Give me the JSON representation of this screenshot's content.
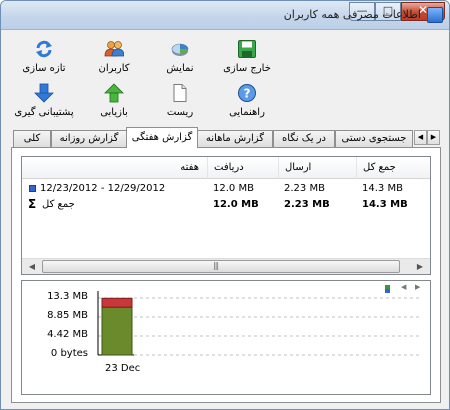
{
  "window": {
    "title": "اطلاعات مصرفی همه کاربران",
    "close_glyph": "✕",
    "maximize_glyph": "□",
    "minimize_glyph": "—"
  },
  "toolbar": {
    "refresh": "تازه سازی",
    "users": "کاربران",
    "view": "نمایش",
    "exit": "خارج سازی",
    "backup": "پشتیبانی گیری",
    "restore": "بازیابی",
    "reset": "ریست",
    "help": "راهنمایی"
  },
  "tabs": {
    "items": [
      "جستجوی دستی",
      "در یک نگاه",
      "گزارش ماهانه",
      "گزارش هفتگی",
      "گزارش روزانه",
      "کلی"
    ],
    "active": "گزارش هفتگی",
    "scroll_left": "◀",
    "scroll_right": "▶"
  },
  "table": {
    "columns": [
      "هفته",
      "دریافت",
      "ارسال",
      "جمع کل"
    ],
    "rows": [
      {
        "week": "12/23/2012 - 12/29/2012",
        "received": "12.0 MB",
        "sent": "2.23 MB",
        "total": "14.3 MB"
      }
    ],
    "summary": {
      "sigma": "Σ",
      "label": "جمع کل",
      "received": "12.0 MB",
      "sent": "2.23 MB",
      "total": "14.3 MB"
    },
    "scroll_left": "◀",
    "scroll_right": "▶",
    "thumb_grip": "|||"
  },
  "colors": {
    "received": "#6a8a2c",
    "sent": "#c8383a",
    "accent": "#3366cc"
  },
  "chart_data": {
    "type": "bar",
    "stacked": true,
    "categories": [
      "23 Dec"
    ],
    "series": [
      {
        "values": [
          12.0
        ]
      },
      {
        "values": [
          2.23
        ]
      }
    ],
    "yticks": [
      "13.3 MB",
      "8.85 MB",
      "4.42 MB",
      "0 bytes"
    ],
    "ylim": [
      0,
      14.3
    ],
    "grid": true,
    "nav_left": "◀",
    "nav_right": "▶"
  }
}
